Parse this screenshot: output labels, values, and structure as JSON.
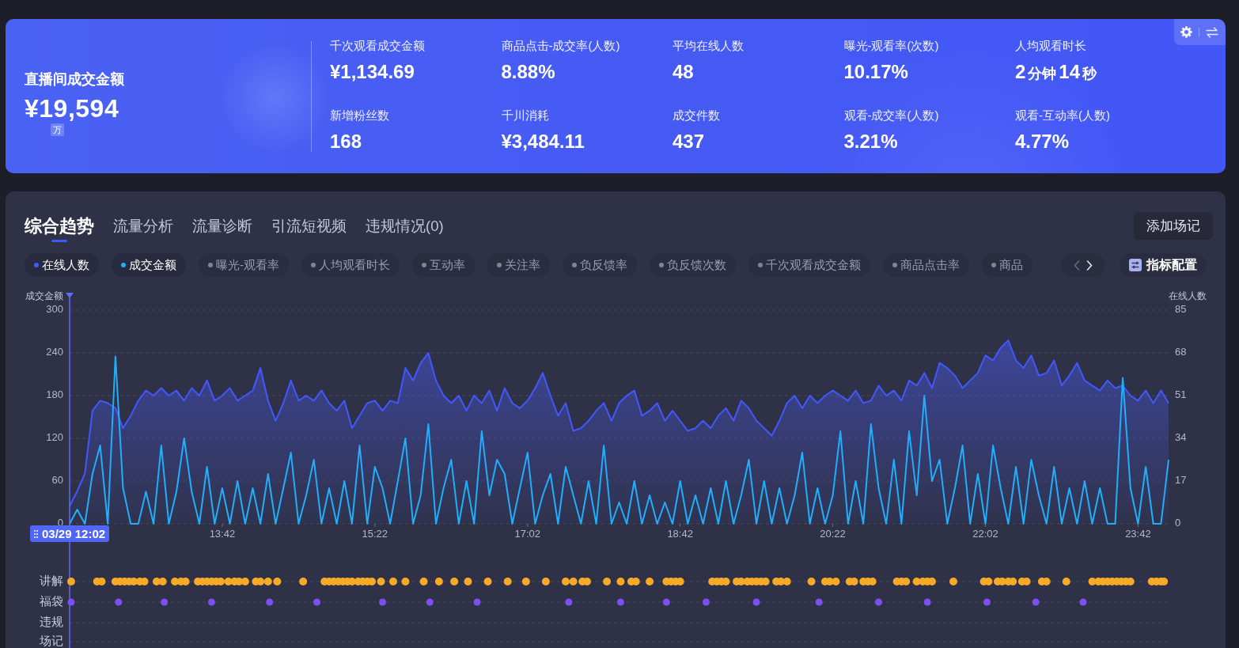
{
  "summary_card": {
    "title": "直播间成交金额",
    "value": "¥19,594",
    "unit": "万",
    "metrics": [
      {
        "label": "千次观看成交金额",
        "value": "¥1,134.69"
      },
      {
        "label": "商品点击-成交率(人数)",
        "value": "8.88%"
      },
      {
        "label": "平均在线人数",
        "value": "48"
      },
      {
        "label": "曝光-观看率(次数)",
        "value": "10.17%"
      },
      {
        "label": "人均观看时长",
        "value_parts": [
          {
            "kind": "number",
            "text": "2"
          },
          {
            "kind": "unit",
            "text": "分钟"
          },
          {
            "kind": "number",
            "text": "14"
          },
          {
            "kind": "unit",
            "text": "秒"
          }
        ]
      },
      {
        "label": "新增粉丝数",
        "value": "168"
      },
      {
        "label": "千川消耗",
        "value": "¥3,484.11"
      },
      {
        "label": "成交件数",
        "value": "437"
      },
      {
        "label": "观看-成交率(人数)",
        "value": "3.21%"
      },
      {
        "label": "观看-互动率(人数)",
        "value": "4.77%"
      }
    ]
  },
  "trend_panel": {
    "tabs": [
      {
        "label": "综合趋势",
        "selected": true
      },
      {
        "label": "流量分析",
        "selected": false
      },
      {
        "label": "流量诊断",
        "selected": false
      },
      {
        "label": "引流短视频",
        "selected": false
      },
      {
        "label": "违规情况(0)",
        "selected": false
      }
    ],
    "add_note_button": "添加场记",
    "metric_chips": [
      {
        "label": "在线人数",
        "selected": true,
        "color": "#3d5afe"
      },
      {
        "label": "成交金额",
        "selected": true,
        "color": "#21aefc"
      },
      {
        "label": "曝光-观看率",
        "selected": false
      },
      {
        "label": "人均观看时长",
        "selected": false
      },
      {
        "label": "互动率",
        "selected": false
      },
      {
        "label": "关注率",
        "selected": false
      },
      {
        "label": "负反馈率",
        "selected": false
      },
      {
        "label": "负反馈次数",
        "selected": false
      },
      {
        "label": "千次观看成交金额",
        "selected": false
      },
      {
        "label": "商品点击率",
        "selected": false
      },
      {
        "label": "商品",
        "selected": false
      }
    ],
    "pager": {
      "prev_disabled": true,
      "next_disabled": false
    },
    "config_button": "指标配置",
    "chart": {
      "cursor_label": "03/29 12:02",
      "chart_data": {
        "type": "line",
        "ylabel": "成交金额",
        "y2label": "在线人数",
        "grid": true,
        "categories": [
          null,
          null,
          null,
          null,
          null,
          null,
          null,
          null,
          null,
          null,
          null,
          null,
          null,
          null,
          null,
          null,
          null,
          null,
          null,
          null,
          "13:42",
          null,
          null,
          null,
          null,
          null,
          null,
          null,
          null,
          null,
          null,
          null,
          null,
          null,
          null,
          null,
          null,
          null,
          null,
          null,
          "15:22",
          null,
          null,
          null,
          null,
          null,
          null,
          null,
          null,
          null,
          null,
          null,
          null,
          null,
          null,
          null,
          null,
          null,
          null,
          null,
          "17:02",
          null,
          null,
          null,
          null,
          null,
          null,
          null,
          null,
          null,
          null,
          null,
          null,
          null,
          null,
          null,
          null,
          null,
          null,
          null,
          "18:42",
          null,
          null,
          null,
          null,
          null,
          null,
          null,
          null,
          null,
          null,
          null,
          null,
          null,
          null,
          null,
          null,
          null,
          null,
          null,
          "20:22",
          null,
          null,
          null,
          null,
          null,
          null,
          null,
          null,
          null,
          null,
          null,
          null,
          null,
          null,
          null,
          null,
          null,
          null,
          null,
          "22:02",
          null,
          null,
          null,
          null,
          null,
          null,
          null,
          null,
          null,
          null,
          null,
          null,
          null,
          null,
          null,
          null,
          null,
          null,
          null,
          "23:42",
          null,
          null,
          null,
          null
        ],
        "ylim": [
          0,
          300
        ],
        "yticks": [
          0,
          60,
          120,
          180,
          240,
          300
        ],
        "y2lim": [
          0,
          85
        ],
        "y2ticks": [
          0,
          17,
          34,
          51,
          68,
          85
        ],
        "series": [
          {
            "type": "area",
            "color": "#4357ff",
            "axis": "y2",
            "values": [
              7,
              13,
              20,
              45,
              49,
              48,
              46,
              38,
              43,
              49,
              53,
              51,
              54,
              51,
              53,
              49,
              54,
              51,
              57,
              49,
              51,
              54,
              49,
              51,
              53,
              62,
              49,
              41,
              48,
              57,
              49,
              51,
              49,
              53,
              48,
              45,
              49,
              38,
              43,
              48,
              49,
              45,
              49,
              48,
              62,
              57,
              64,
              68,
              57,
              51,
              48,
              51,
              45,
              51,
              48,
              53,
              45,
              54,
              48,
              46,
              49,
              54,
              60,
              51,
              43,
              48,
              37,
              38,
              41,
              45,
              48,
              41,
              48,
              51,
              53,
              43,
              45,
              48,
              41,
              45,
              41,
              37,
              38,
              41,
              38,
              43,
              46,
              41,
              49,
              46,
              41,
              38,
              35,
              41,
              48,
              51,
              46,
              51,
              48,
              51,
              53,
              51,
              49,
              53,
              48,
              49,
              55,
              51,
              53,
              49,
              57,
              55,
              60,
              54,
              64,
              62,
              59,
              54,
              57,
              60,
              67,
              65,
              70,
              73,
              65,
              62,
              67,
              59,
              60,
              65,
              55,
              59,
              64,
              57,
              55,
              53,
              57,
              54,
              55,
              51,
              49,
              53,
              48,
              53,
              48
            ]
          },
          {
            "type": "line",
            "color": "#21aefc",
            "values": [
              0,
              20,
              0,
              70,
              110,
              0,
              235,
              50,
              0,
              0,
              45,
              0,
              110,
              0,
              45,
              120,
              45,
              0,
              80,
              0,
              50,
              0,
              60,
              0,
              50,
              0,
              70,
              0,
              50,
              100,
              0,
              40,
              90,
              0,
              50,
              0,
              60,
              0,
              110,
              0,
              80,
              50,
              0,
              60,
              120,
              0,
              40,
              140,
              0,
              50,
              90,
              0,
              60,
              0,
              130,
              40,
              90,
              70,
              0,
              50,
              100,
              0,
              40,
              70,
              0,
              80,
              40,
              0,
              60,
              0,
              110,
              0,
              30,
              0,
              60,
              0,
              40,
              0,
              30,
              0,
              60,
              0,
              40,
              0,
              50,
              0,
              60,
              0,
              40,
              90,
              0,
              60,
              0,
              50,
              0,
              40,
              100,
              0,
              50,
              0,
              40,
              130,
              0,
              60,
              0,
              140,
              50,
              0,
              90,
              0,
              130,
              40,
              180,
              60,
              90,
              0,
              50,
              110,
              0,
              70,
              0,
              110,
              50,
              0,
              80,
              0,
              90,
              40,
              0,
              80,
              0,
              50,
              0,
              60,
              0,
              50,
              0,
              0,
              205,
              50,
              0,
              80,
              0,
              0,
              90
            ]
          }
        ]
      }
    },
    "event_timeline": {
      "tracks": [
        {
          "label": "讲解",
          "color": "#f7a928"
        },
        {
          "label": "福袋",
          "color": "#7b4ff0"
        },
        {
          "label": "违规"
        },
        {
          "label": "场记"
        }
      ]
    }
  }
}
